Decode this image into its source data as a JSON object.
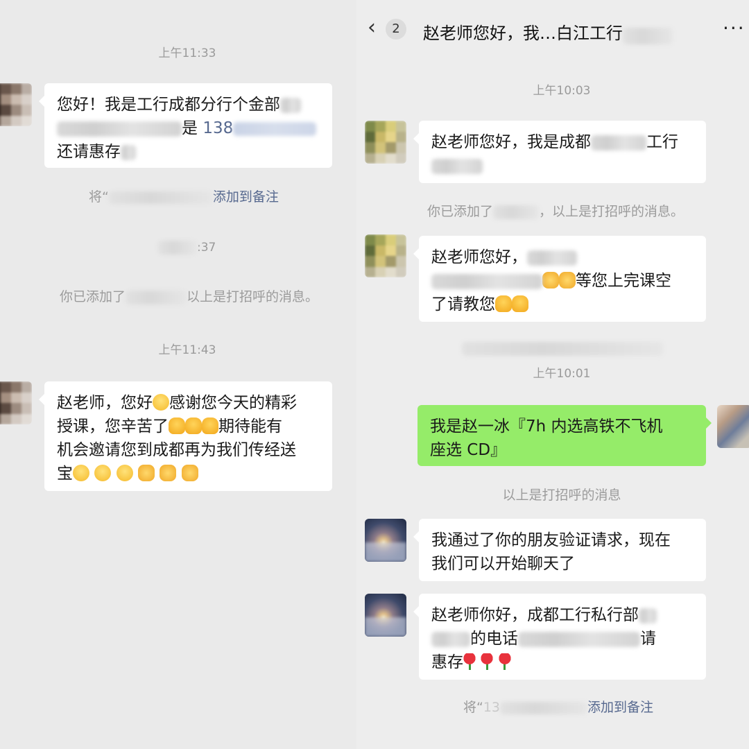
{
  "left_chat": {
    "time_1": "上午11:33",
    "msg_1": {
      "line1": "您好！我是工行成都分行个金部",
      "line2_suffix": "是",
      "line2_phone": "138",
      "line3": "还请惠存"
    },
    "add_note": {
      "prefix": "将“",
      "action": "添加到备注"
    },
    "time_2_suffix": ":37",
    "added_notice": {
      "prefix": "你已添加了",
      "suffix": "以上是打招呼的消息。"
    },
    "time_3": "上午11:43",
    "msg_2": {
      "line1_a": "赵老师，您好",
      "line1_b": "感谢您今天的精彩",
      "line2_a": "授课，您辛苦了",
      "line2_b": "期待能有",
      "line3": "机会邀请您到成都再为我们传经送",
      "line4": "宝"
    }
  },
  "right_chat": {
    "header": {
      "unread_count": "2",
      "title": "赵老师您好，我…白江工行",
      "more": "···"
    },
    "time_1": "上午10:03",
    "msg_1": {
      "line1_a": "赵老师您好，我是成都",
      "line1_b": "工行"
    },
    "added_notice": {
      "prefix": "你已添加了",
      "suffix": "，以上是打招呼的消息。"
    },
    "msg_2": {
      "line1": "赵老师您好，",
      "line2": "等您上完课空",
      "line3": "了请教您"
    },
    "time_2": "上午10:01",
    "msg_me": {
      "line1": "我是赵一冰『7h 内选高铁不飞机",
      "line2": "座选 CD』"
    },
    "greet_notice": "以上是打招呼的消息",
    "msg_3": {
      "line1": "我通过了你的朋友验证请求，现在",
      "line2": "我们可以开始聊天了"
    },
    "msg_4": {
      "line1": "赵老师你好，成都工行私行部",
      "line2_a": "的电话",
      "line2_b": "请",
      "line3": "惠存"
    },
    "add_note": {
      "prefix": "将“",
      "phone_prefix": "13",
      "action": "添加到备注"
    }
  },
  "colors": {
    "background": "#ededed",
    "bubble_incoming": "#ffffff",
    "bubble_outgoing": "#95ec69",
    "link": "#57698f",
    "system_text": "#9b9b9b"
  },
  "icons": [
    "back-chevron-icon",
    "more-dots-icon",
    "pray-emoji",
    "handshake-emoji",
    "grin-emoji",
    "smile-emoji",
    "rose-emoji"
  ]
}
